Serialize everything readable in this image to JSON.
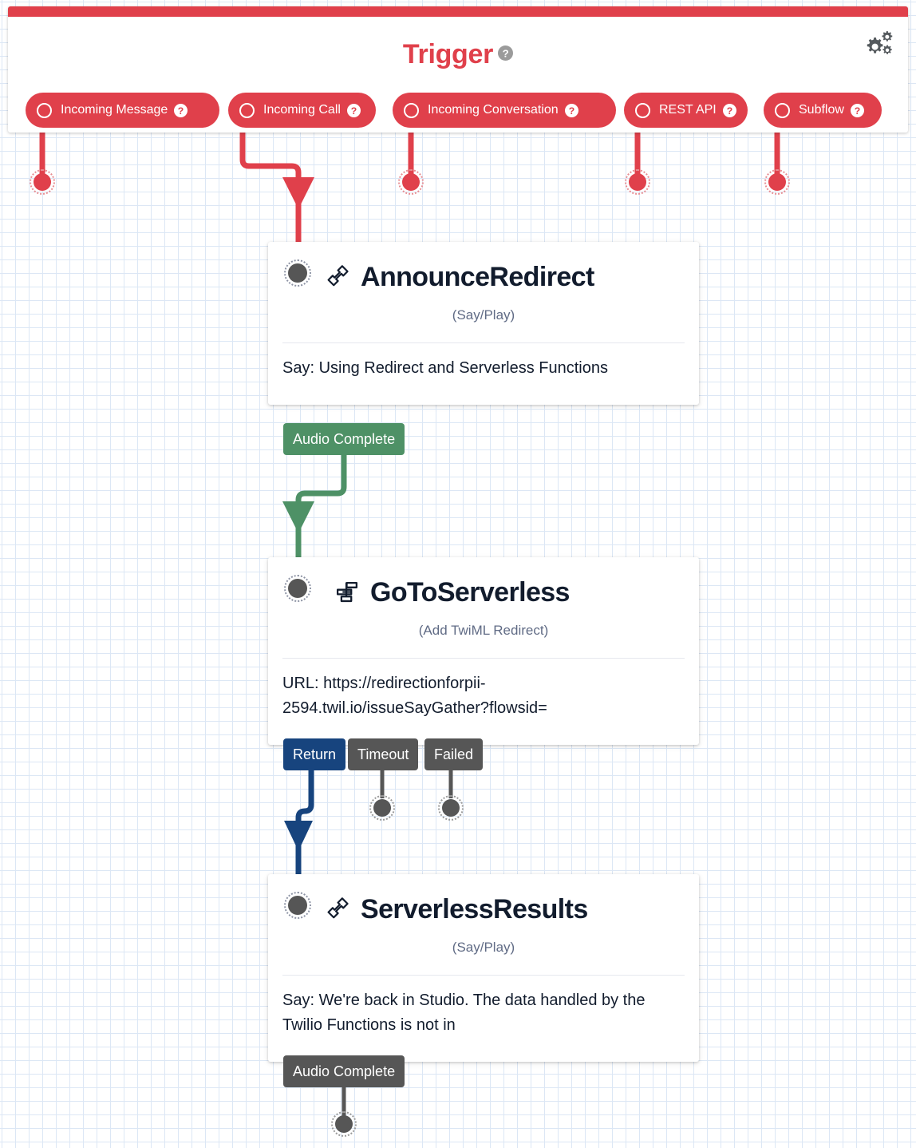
{
  "trigger": {
    "title": "Trigger",
    "help_label": "?",
    "settings_icon": "gears-icon",
    "accent_color": "#e0404b",
    "pills": [
      {
        "label": "Incoming Message",
        "help": "?"
      },
      {
        "label": "Incoming Call",
        "help": "?"
      },
      {
        "label": "Incoming Conversation",
        "help": "?"
      },
      {
        "label": "REST API",
        "help": "?"
      },
      {
        "label": "Subflow",
        "help": "?"
      }
    ]
  },
  "widgets": [
    {
      "name": "AnnounceRedirect",
      "type": "(Say/Play)",
      "icon": "phone-handset-icon",
      "body": "Say: Using Redirect and Serverless Functions",
      "outputs": [
        {
          "label": "Audio Complete",
          "color": "#4e9166"
        }
      ]
    },
    {
      "name": "GoToServerless",
      "type": "(Add TwiML Redirect)",
      "icon": "twiml-redirect-icon",
      "body": "URL: https://redirectionforpii-2594.twil.io/issueSayGather?flowsid=",
      "outputs": [
        {
          "label": "Return",
          "color": "#17447e"
        },
        {
          "label": "Timeout",
          "color": "#565656"
        },
        {
          "label": "Failed",
          "color": "#565656"
        }
      ]
    },
    {
      "name": "ServerlessResults",
      "type": "(Say/Play)",
      "icon": "phone-handset-icon",
      "body": "Say: We're back in Studio. The data handled by the Twilio Functions is not in",
      "outputs": [
        {
          "label": "Audio Complete",
          "color": "#565656"
        }
      ]
    }
  ],
  "connections": [
    {
      "from": "Incoming Message",
      "to": "unconnected-endpoint",
      "color": "#e0404b"
    },
    {
      "from": "Incoming Call",
      "to": "AnnounceRedirect",
      "color": "#e0404b"
    },
    {
      "from": "Incoming Conversation",
      "to": "unconnected-endpoint",
      "color": "#e0404b"
    },
    {
      "from": "REST API",
      "to": "unconnected-endpoint",
      "color": "#e0404b"
    },
    {
      "from": "Subflow",
      "to": "unconnected-endpoint",
      "color": "#e0404b"
    },
    {
      "from": "AnnounceRedirect.Audio Complete",
      "to": "GoToServerless",
      "color": "#4e9166"
    },
    {
      "from": "GoToServerless.Return",
      "to": "ServerlessResults",
      "color": "#17447e"
    },
    {
      "from": "GoToServerless.Timeout",
      "to": "unconnected-endpoint",
      "color": "#565656"
    },
    {
      "from": "GoToServerless.Failed",
      "to": "unconnected-endpoint",
      "color": "#565656"
    },
    {
      "from": "ServerlessResults.Audio Complete",
      "to": "unconnected-endpoint",
      "color": "#565656"
    }
  ]
}
